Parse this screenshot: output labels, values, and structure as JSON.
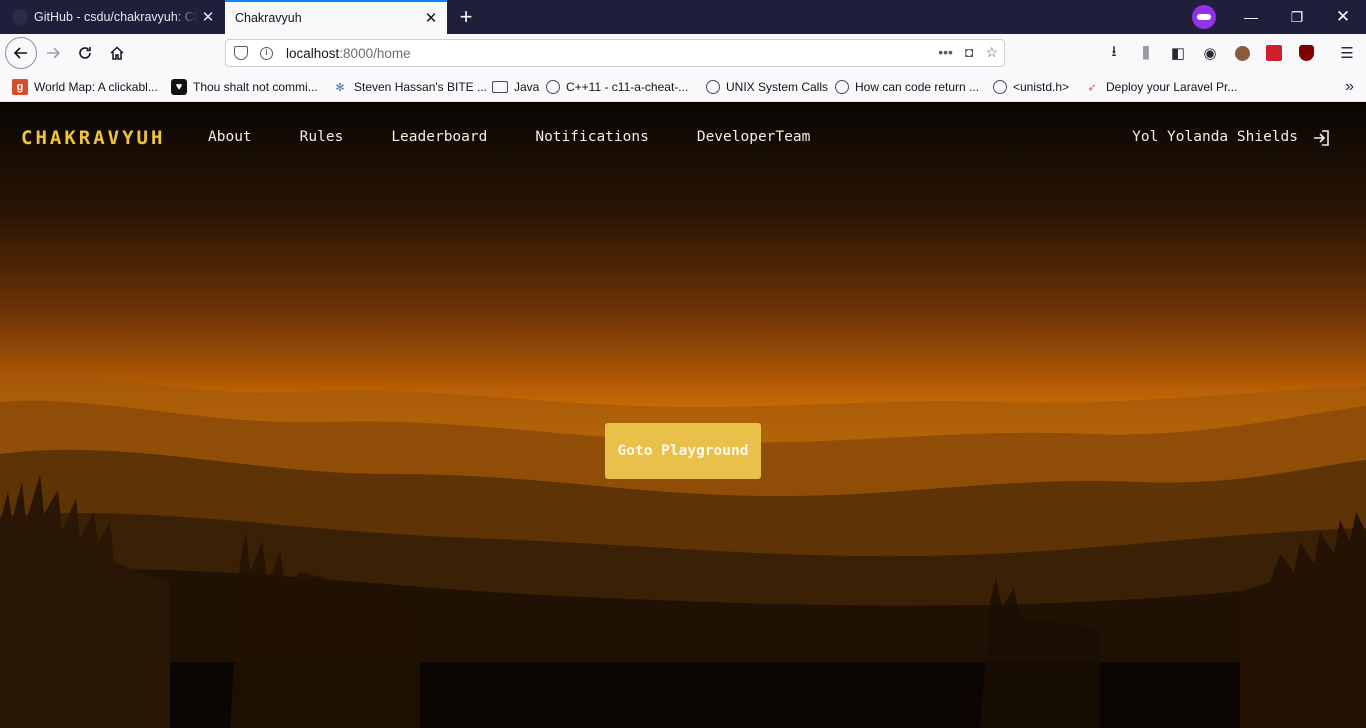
{
  "browser": {
    "tabs": [
      {
        "title": "GitHub - csdu/chakravyuh: Chakravyuh",
        "active": false
      },
      {
        "title": "Chakravyuh",
        "active": true
      }
    ],
    "address": {
      "host": "localhost",
      "rest": ":8000/home"
    },
    "bookmarks": [
      {
        "label": "World Map: A clickabl...",
        "icon": "g-icon"
      },
      {
        "label": "Thou shalt not commi...",
        "icon": "heart-icon"
      },
      {
        "label": "Steven Hassan's BITE ...",
        "icon": "wiki-icon"
      },
      {
        "label": "Java",
        "icon": "folder-icon"
      },
      {
        "label": "C++11 - c11-a-cheat-...",
        "icon": "globe-icon"
      },
      {
        "label": "UNIX System Calls",
        "icon": "globe-icon"
      },
      {
        "label": "How can code return ...",
        "icon": "globe-icon"
      },
      {
        "label": "<unistd.h>",
        "icon": "globe-icon"
      },
      {
        "label": "Deploy your Laravel Pr...",
        "icon": "deploy-icon"
      }
    ]
  },
  "site": {
    "logo": "CHAKRAVYUH",
    "menu": [
      "About",
      "Rules",
      "Leaderboard",
      "Notifications",
      "DeveloperTeam"
    ],
    "user": "Yol Yolanda Shields",
    "cta": "Goto Playground"
  },
  "colors": {
    "accent": "#e9c04a",
    "logo": "#f0c53e",
    "sky_glow": "#e88a06",
    "tab_indicator": "#0a84ff"
  }
}
